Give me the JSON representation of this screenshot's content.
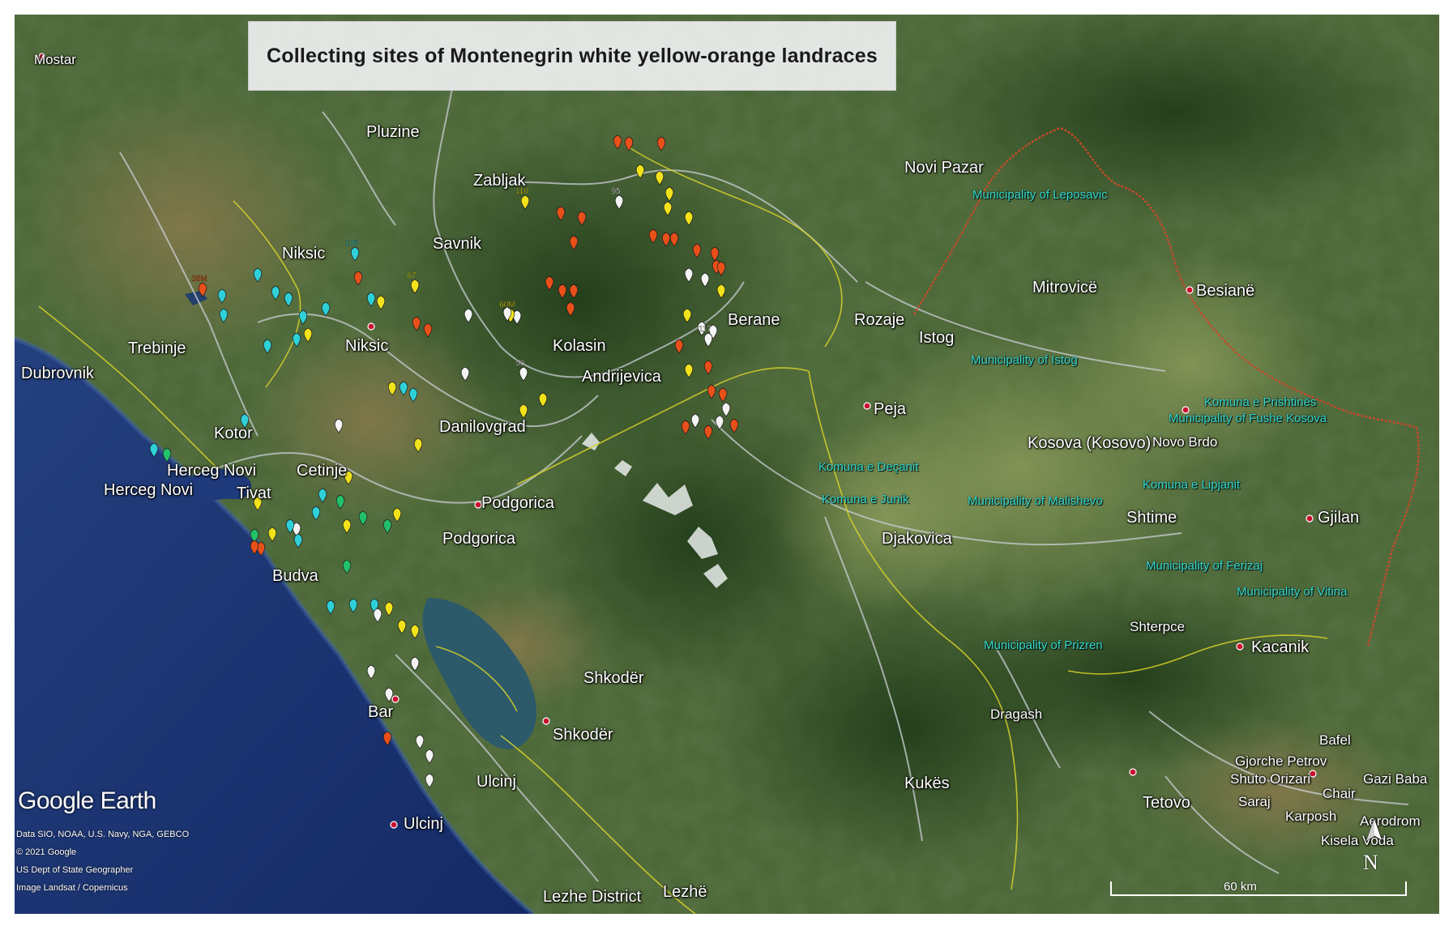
{
  "title": "Collecting sites of Montenegrin white yellow-orange landraces",
  "places": {
    "mostar": "Mostar",
    "pluzine": "Pluzine",
    "zabljak": "Zabljak",
    "savnik": "Savnik",
    "niksic_region": "Niksic",
    "niksic": "Niksic",
    "trebinje": "Trebinje",
    "dubrovnik": "Dubrovnik",
    "kotor": "Kotor",
    "herceg_novi_a": "Herceg Novi",
    "herceg_novi_b": "Herceg Novi",
    "tivat": "Tivat",
    "cetinje": "Cetinje",
    "budva": "Budva",
    "danilovgrad": "Danilovgrad",
    "podgorica_a": "Podgorica",
    "podgorica_b": "Podgorica",
    "kolasin": "Kolasin",
    "andrijevica": "Andrijevica",
    "berane": "Berane",
    "rozaje": "Rozaje",
    "novi_pazar": "Novi Pazar",
    "mitrovice": "Mitrovicë",
    "besiane": "Besianë",
    "istog": "Istog",
    "peja": "Peja",
    "kosova": "Kosova (Kosovo)",
    "novo_brdo": "Novo Brdo",
    "djakovica": "Djakovica",
    "shtime": "Shtime",
    "gjilan": "Gjilan",
    "kacanik": "Kacanik",
    "shterpce": "Shterpce",
    "dragash": "Dragash",
    "kukes": "Kukës",
    "tetovo": "Tetovo",
    "shkoder_a": "Shkodër",
    "shkoder_b": "Shkodër",
    "bar": "Bar",
    "ulcinj_a": "Ulcinj",
    "ulcinj_b": "Ulcinj",
    "lezhe_district": "Lezhe District",
    "lezhe": "Lezhë",
    "bafel": "Bafel",
    "gjorche_petrov": "Gjorche Petrov",
    "shuto_orizari": "Shuto Orizari",
    "gazi_baba": "Gazi Baba",
    "saraj": "Saraj",
    "chair": "Chair",
    "karposh": "Karposh",
    "aerodrom": "Aerodrom",
    "kisela_voda": "Kisela Voda"
  },
  "municipalities": {
    "leposavic": "Municipality of Leposavic",
    "istog": "Municipality of Istog",
    "prishtines": "Komuna e Prishtinës",
    "fushe_kosova": "Municipality of Fushe Kosova",
    "decanit": "Komuna e Deçanit",
    "junik": "Komuna e Junik",
    "malishevo": "Municipality of Malishevo",
    "lipjanit": "Komuna e Lipjanit",
    "ferizaj": "Municipality of Ferizaj",
    "vitina": "Municipality of Vitina",
    "prizren": "Municipality of Prizren"
  },
  "branding": {
    "logo": "Google Earth",
    "credit_1": "Data SIO, NOAA, U.S. Navy, NGA, GEBCO",
    "credit_2": "© 2021 Google",
    "credit_3": "US Dept of State Geographer",
    "credit_4": "Image Landsat / Copernicus"
  },
  "scale_label": "60 km",
  "north_label": "N",
  "marker_colors": {
    "orange": "#e8501a",
    "yellow": "#f2e21b",
    "white": "#f4f4f4",
    "cyan": "#2fd0d8",
    "green": "#23c06a"
  },
  "markers": [
    {
      "label": "38M",
      "color": "orange"
    },
    {
      "label": "",
      "color": "cyan"
    },
    {
      "label": "",
      "color": "cyan"
    },
    {
      "label": "",
      "color": "cyan"
    },
    {
      "label": "",
      "color": "cyan"
    },
    {
      "label": "",
      "color": "cyan"
    },
    {
      "label": "",
      "color": "cyan"
    },
    {
      "label": "",
      "color": "cyan"
    },
    {
      "label": "",
      "color": "yellow"
    },
    {
      "label": "",
      "color": "cyan"
    },
    {
      "label": "",
      "color": "cyan"
    },
    {
      "label": "100",
      "color": "cyan"
    },
    {
      "label": "",
      "color": "orange"
    },
    {
      "label": "",
      "color": "cyan"
    },
    {
      "label": "",
      "color": "yellow"
    },
    {
      "label": "67",
      "color": "yellow"
    },
    {
      "label": "",
      "color": "orange"
    },
    {
      "label": "",
      "color": "orange"
    },
    {
      "label": "",
      "color": "yellow"
    },
    {
      "label": "",
      "color": "cyan"
    },
    {
      "label": "",
      "color": "yellow"
    },
    {
      "label": "",
      "color": "cyan"
    },
    {
      "label": "",
      "color": "yellow"
    },
    {
      "label": "",
      "color": "cyan"
    },
    {
      "label": "",
      "color": "white"
    },
    {
      "label": "",
      "color": "cyan"
    },
    {
      "label": "",
      "color": "green"
    },
    {
      "label": "",
      "color": "yellow"
    },
    {
      "label": "",
      "color": "yellow"
    },
    {
      "label": "",
      "color": "white"
    },
    {
      "label": "",
      "color": "cyan"
    },
    {
      "label": "",
      "color": "green"
    },
    {
      "label": "",
      "color": "cyan"
    },
    {
      "label": "",
      "color": "green"
    },
    {
      "label": "",
      "color": "green"
    },
    {
      "label": "",
      "color": "yellow"
    },
    {
      "label": "",
      "color": "yellow"
    },
    {
      "label": "",
      "color": "orange"
    },
    {
      "label": "",
      "color": "orange"
    },
    {
      "label": "",
      "color": "cyan"
    },
    {
      "label": "",
      "color": "cyan"
    },
    {
      "label": "",
      "color": "green"
    },
    {
      "label": "",
      "color": "green"
    },
    {
      "label": "",
      "color": "cyan"
    },
    {
      "label": "",
      "color": "cyan"
    },
    {
      "label": "",
      "color": "cyan"
    },
    {
      "label": "",
      "color": "white"
    },
    {
      "label": "",
      "color": "yellow"
    },
    {
      "label": "",
      "color": "yellow"
    },
    {
      "label": "",
      "color": "yellow"
    },
    {
      "label": "",
      "color": "white"
    },
    {
      "label": "",
      "color": "white"
    },
    {
      "label": "",
      "color": "white"
    },
    {
      "label": "",
      "color": "white"
    },
    {
      "label": "",
      "color": "orange"
    },
    {
      "label": "",
      "color": "white"
    },
    {
      "label": "",
      "color": "white"
    },
    {
      "label": "95",
      "color": "white"
    },
    {
      "label": "110",
      "color": "yellow"
    },
    {
      "label": "",
      "color": "orange"
    },
    {
      "label": "",
      "color": "orange"
    },
    {
      "label": "",
      "color": "orange"
    },
    {
      "label": "",
      "color": "orange"
    },
    {
      "label": "",
      "color": "orange"
    },
    {
      "label": "",
      "color": "orange"
    },
    {
      "label": "",
      "color": "orange"
    },
    {
      "label": "",
      "color": "white"
    },
    {
      "label": "60M",
      "color": "yellow"
    },
    {
      "label": "",
      "color": "white"
    },
    {
      "label": "",
      "color": "white"
    },
    {
      "label": "",
      "color": "white"
    },
    {
      "label": "56",
      "color": "white"
    },
    {
      "label": "",
      "color": "yellow"
    },
    {
      "label": "",
      "color": "yellow"
    },
    {
      "label": "",
      "color": "orange"
    },
    {
      "label": "",
      "color": "orange"
    },
    {
      "label": "",
      "color": "orange"
    },
    {
      "label": "",
      "color": "yellow"
    },
    {
      "label": "",
      "color": "yellow"
    },
    {
      "label": "",
      "color": "yellow"
    },
    {
      "label": "",
      "color": "yellow"
    },
    {
      "label": "",
      "color": "yellow"
    },
    {
      "label": "",
      "color": "orange"
    },
    {
      "label": "",
      "color": "orange"
    },
    {
      "label": "",
      "color": "orange"
    },
    {
      "label": "",
      "color": "orange"
    },
    {
      "label": "",
      "color": "orange"
    },
    {
      "label": "",
      "color": "orange"
    },
    {
      "label": "",
      "color": "orange"
    },
    {
      "label": "",
      "color": "white"
    },
    {
      "label": "",
      "color": "white"
    },
    {
      "label": "",
      "color": "yellow"
    },
    {
      "label": "",
      "color": "yellow"
    },
    {
      "label": "",
      "color": "white"
    },
    {
      "label": "",
      "color": "white"
    },
    {
      "label": "117",
      "color": "white"
    },
    {
      "label": "",
      "color": "orange"
    },
    {
      "label": "",
      "color": "orange"
    },
    {
      "label": "",
      "color": "yellow"
    },
    {
      "label": "",
      "color": "orange"
    },
    {
      "label": "",
      "color": "orange"
    },
    {
      "label": "",
      "color": "white"
    },
    {
      "label": "",
      "color": "white"
    },
    {
      "label": "",
      "color": "orange"
    },
    {
      "label": "",
      "color": "orange"
    },
    {
      "label": "",
      "color": "white"
    },
    {
      "label": "",
      "color": "orange"
    }
  ]
}
